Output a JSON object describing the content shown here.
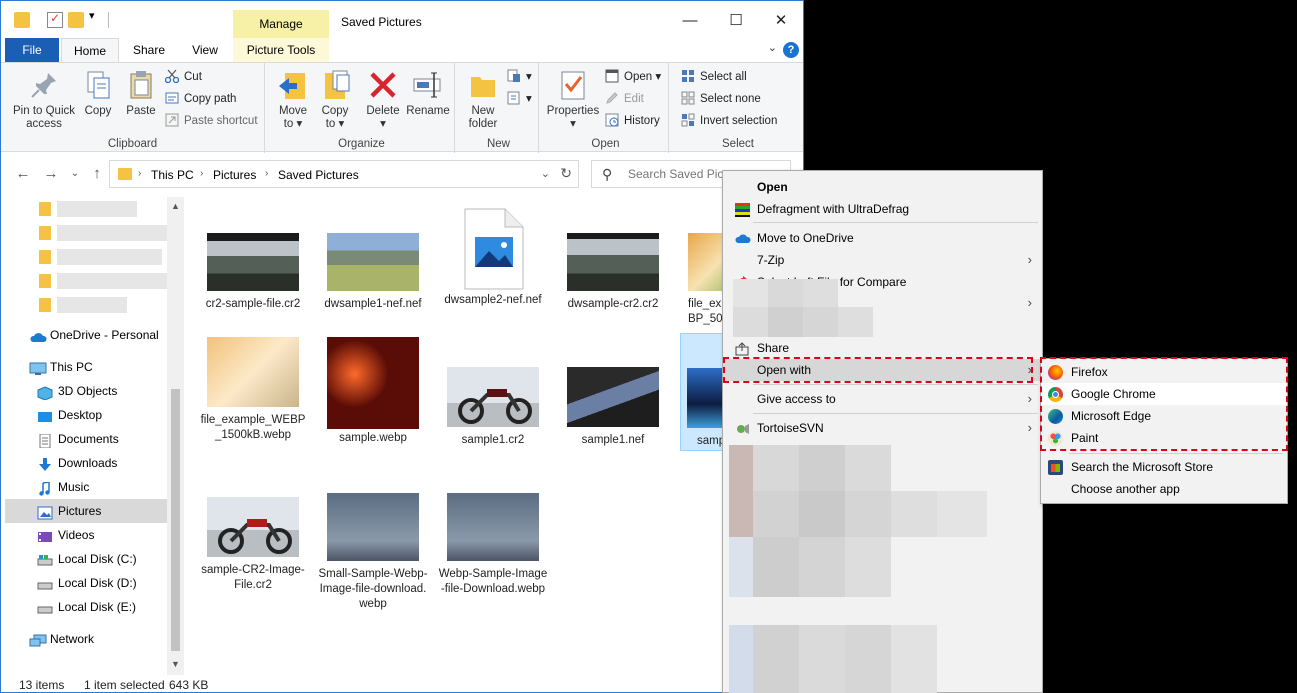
{
  "window": {
    "title": "Saved Pictures",
    "manage_tab": "Manage",
    "picture_tools_tab": "Picture Tools"
  },
  "tabs": {
    "file": "File",
    "home": "Home",
    "share": "Share",
    "view": "View"
  },
  "ribbon": {
    "clipboard": {
      "label": "Clipboard",
      "pin_line1": "Pin to Quick",
      "pin_line2": "access",
      "copy": "Copy",
      "paste": "Paste",
      "cut": "Cut",
      "copy_path": "Copy path",
      "paste_shortcut": "Paste shortcut"
    },
    "organize": {
      "label": "Organize",
      "move_line1": "Move",
      "move_line2": "to ▾",
      "copy_line1": "Copy",
      "copy_line2": "to ▾",
      "delete": "Delete",
      "delete_arrow": "▾",
      "rename": "Rename"
    },
    "new": {
      "label": "New",
      "new_folder_line1": "New",
      "new_folder_line2": "folder"
    },
    "open": {
      "label": "Open",
      "properties": "Properties",
      "properties_arrow": "▾",
      "open": "Open ▾",
      "edit": "Edit",
      "history": "History"
    },
    "select": {
      "label": "Select",
      "select_all": "Select all",
      "select_none": "Select none",
      "invert": "Invert selection"
    }
  },
  "address": {
    "crumbs": [
      "This PC",
      "Pictures",
      "Saved Pictures"
    ],
    "search_placeholder": "Search Saved Pictures"
  },
  "nav": {
    "onedrive": "OneDrive - Personal",
    "this_pc": "This PC",
    "items": [
      "3D Objects",
      "Desktop",
      "Documents",
      "Downloads",
      "Music",
      "Pictures",
      "Videos",
      "Local Disk (C:)",
      "Local Disk (D:)",
      "Local Disk (E:)"
    ],
    "network": "Network"
  },
  "files": [
    {
      "name": "cr2-sample-file.cr2"
    },
    {
      "name": "dwsample1-nef.nef"
    },
    {
      "name": "dwsample2-nef.nef"
    },
    {
      "name": "dwsample-cr2.cr2"
    },
    {
      "name": "file_exBP_50"
    },
    {
      "name": "file_example_WEBP_1500kB.webp"
    },
    {
      "name": "sample.webp"
    },
    {
      "name": "sample1.cr2"
    },
    {
      "name": "sample1.nef"
    },
    {
      "name": "samp"
    },
    {
      "name": "sample-CR2-Image-File.cr2"
    },
    {
      "name": "Small-Sample-Webp-Image-file-download.webp"
    },
    {
      "name": "Webp-Sample-Image-file-Download.webp"
    }
  ],
  "status": {
    "items": "13 items",
    "selected": "1 item selected",
    "size": "643 KB"
  },
  "context_menu": {
    "open": "Open",
    "defrag": "Defragment with UltraDefrag",
    "onedrive": "Move to OneDrive",
    "zip": "7-Zip",
    "compare": "Select Left File for Compare",
    "share": "Share",
    "open_with": "Open with",
    "give_access": "Give access to",
    "tortoise": "TortoiseSVN",
    "arrow": "›"
  },
  "open_with_submenu": {
    "firefox": "Firefox",
    "chrome": "Google Chrome",
    "edge": "Microsoft Edge",
    "paint": "Paint",
    "store": "Search the Microsoft Store",
    "another": "Choose another app"
  },
  "colors": {
    "accent": "#1a5fb4",
    "selection": "#cce8ff",
    "highlight_dashed": "#e0001b",
    "folder": "#f5c342"
  }
}
